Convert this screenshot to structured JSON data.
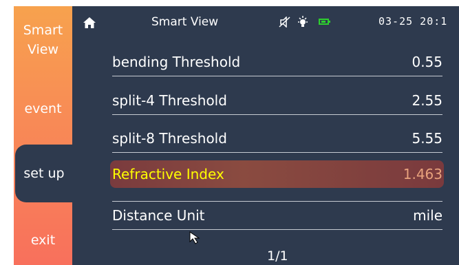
{
  "sidebar": {
    "items": [
      {
        "label_line1": "Smart",
        "label_line2": "View"
      },
      {
        "label": "event"
      },
      {
        "label": "set up"
      },
      {
        "label": "exit"
      }
    ]
  },
  "header": {
    "title": "Smart View",
    "clock": "03-25 20:1",
    "icons": [
      "home-icon",
      "mute-icon",
      "bulb-icon",
      "battery-icon"
    ]
  },
  "settings": [
    {
      "label": "bending Threshold",
      "value": "0.55"
    },
    {
      "label": "split-4 Threshold",
      "value": "2.55"
    },
    {
      "label": "split-8 Threshold",
      "value": "5.55"
    },
    {
      "label": "Refractive Index",
      "value": "1.463"
    },
    {
      "label": "Distance Unit",
      "value": "mile"
    }
  ],
  "pager": "1/1",
  "colors": {
    "screen_bg": "#2e3a4e",
    "sidebar_top": "#f7a24e",
    "sidebar_bottom": "#f8705c",
    "selected_label": "#ffff00",
    "selected_value": "#e8a27d",
    "battery": "#2ed02e"
  }
}
